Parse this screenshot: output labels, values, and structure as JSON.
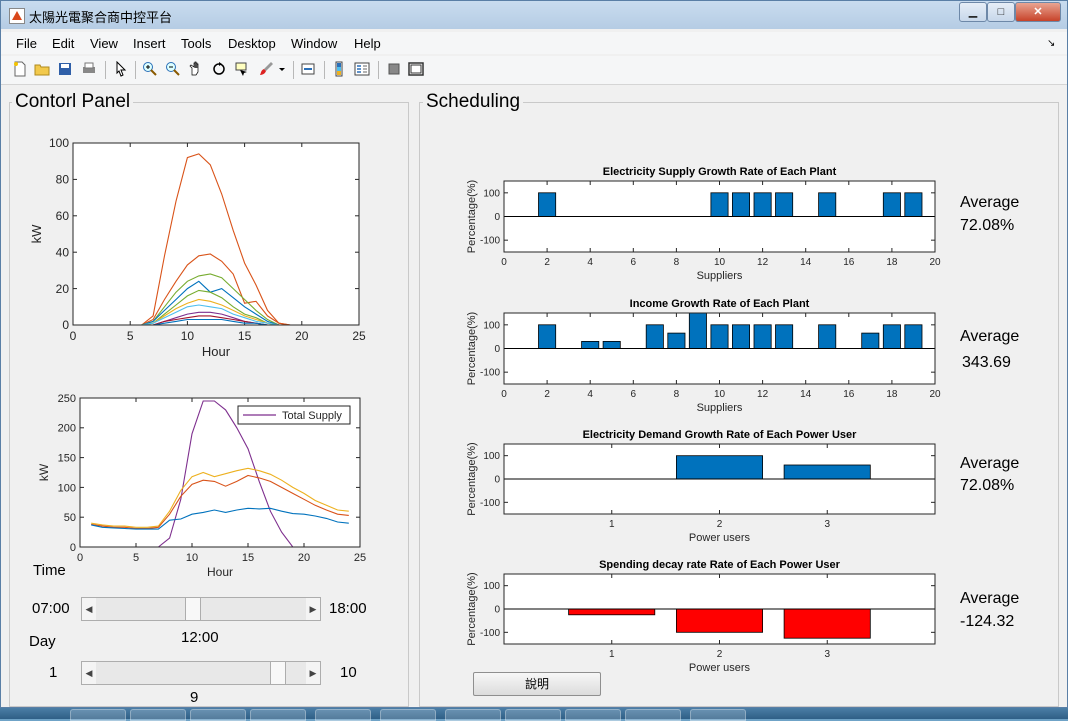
{
  "window": {
    "title": "太陽光電聚合商中控平台",
    "minimize": "▁",
    "maximize": "□",
    "close": "✕"
  },
  "menu": [
    "File",
    "Edit",
    "View",
    "Insert",
    "Tools",
    "Desktop",
    "Window",
    "Help"
  ],
  "menu_corner": "↘",
  "toolbar_icons": [
    "new-file-icon",
    "open-folder-icon",
    "save-icon",
    "print-icon",
    "pointer-icon",
    "zoom-in-icon",
    "zoom-out-icon",
    "pan-hand-icon",
    "rotate-icon",
    "data-cursor-icon",
    "brush-icon",
    "link-plot-icon",
    "colorbar-icon",
    "legend-icon",
    "hide-tools-icon",
    "dock-icon"
  ],
  "control_panel": {
    "title": "Contorl Panel",
    "time_label": "Time",
    "time_min": "07:00",
    "time_max": "18:00",
    "time_value": "12:00",
    "time_fraction": 0.4545,
    "day_label": "Day",
    "day_min": "1",
    "day_max": "10",
    "day_value": "9",
    "day_fraction": 0.8889
  },
  "scheduling": {
    "title": "Scheduling",
    "help_button": "說明"
  },
  "averages": [
    {
      "label": "Average",
      "value": "72.08%"
    },
    {
      "label": "Average",
      "value": "343.69"
    },
    {
      "label": "Average",
      "value": "72.08%"
    },
    {
      "label": "Average",
      "value": "-124.32"
    }
  ],
  "chart_data": [
    {
      "type": "line",
      "xlabel": "Hour",
      "ylabel": "kW",
      "xlim": [
        0,
        25
      ],
      "ylim": [
        0,
        100
      ],
      "xticks": [
        0,
        5,
        10,
        15,
        20,
        25
      ],
      "yticks": [
        0,
        20,
        40,
        60,
        80,
        100
      ],
      "x": [
        0,
        1,
        2,
        3,
        4,
        5,
        6,
        7,
        8,
        9,
        10,
        11,
        12,
        13,
        14,
        15,
        16,
        17,
        18,
        19,
        20,
        21,
        22,
        23,
        24
      ],
      "series": [
        {
          "color": "#d95319",
          "values": [
            0,
            0,
            0,
            0,
            0,
            0,
            0,
            5,
            38,
            68,
            92,
            94,
            88,
            72,
            52,
            34,
            22,
            8,
            1,
            0,
            0,
            0,
            0,
            0,
            0
          ]
        },
        {
          "color": "#d95319",
          "values": [
            0,
            0,
            0,
            0,
            0,
            0,
            0,
            3,
            14,
            24,
            33,
            38,
            39,
            35,
            28,
            12,
            13,
            5,
            1,
            0,
            0,
            0,
            0,
            0,
            0
          ]
        },
        {
          "color": "#77ac30",
          "values": [
            0,
            0,
            0,
            0,
            0,
            0,
            0,
            2,
            10,
            18,
            24,
            27,
            28,
            26,
            20,
            14,
            8,
            3,
            0,
            0,
            0,
            0,
            0,
            0,
            0
          ]
        },
        {
          "color": "#0072bd",
          "values": [
            0,
            0,
            0,
            0,
            0,
            0,
            0,
            2,
            8,
            14,
            20,
            24,
            18,
            20,
            15,
            10,
            6,
            2,
            0,
            0,
            0,
            0,
            0,
            0,
            0
          ]
        },
        {
          "color": "#77ac30",
          "values": [
            0,
            0,
            0,
            0,
            0,
            0,
            0,
            1,
            6,
            11,
            16,
            19,
            18,
            15,
            10,
            6,
            4,
            1,
            0,
            0,
            0,
            0,
            0,
            0,
            0
          ]
        },
        {
          "color": "#edb120",
          "values": [
            0,
            0,
            0,
            0,
            0,
            0,
            0,
            1,
            5,
            9,
            12,
            14,
            13,
            11,
            8,
            5,
            3,
            1,
            0,
            0,
            0,
            0,
            0,
            0,
            0
          ]
        },
        {
          "color": "#4dbeee",
          "values": [
            0,
            0,
            0,
            0,
            0,
            0,
            0,
            1,
            4,
            7,
            10,
            11,
            10,
            9,
            6,
            4,
            2,
            1,
            0,
            0,
            0,
            0,
            0,
            0,
            0
          ]
        },
        {
          "color": "#7e2f8e",
          "values": [
            0,
            0,
            0,
            0,
            0,
            0,
            0,
            0,
            2,
            4,
            6,
            7,
            7,
            6,
            4,
            2,
            1,
            0,
            0,
            0,
            0,
            0,
            0,
            0,
            0
          ]
        },
        {
          "color": "#a2142f",
          "values": [
            0,
            0,
            0,
            0,
            0,
            0,
            0,
            0,
            2,
            3,
            4,
            5,
            5,
            4,
            3,
            2,
            1,
            0,
            0,
            0,
            0,
            0,
            0,
            0,
            0
          ]
        },
        {
          "color": "#0072bd",
          "values": [
            0,
            0,
            0,
            0,
            0,
            0,
            0,
            0,
            1,
            2,
            3,
            3,
            3,
            3,
            2,
            1,
            1,
            0,
            0,
            0,
            0,
            0,
            0,
            0,
            0
          ]
        }
      ]
    },
    {
      "type": "line",
      "xlabel": "Hour",
      "ylabel": "kW",
      "xlim": [
        0,
        25
      ],
      "ylim": [
        0,
        250
      ],
      "xticks": [
        0,
        5,
        10,
        15,
        20,
        25
      ],
      "yticks": [
        0,
        50,
        100,
        150,
        200,
        250
      ],
      "x": [
        1,
        2,
        3,
        4,
        5,
        6,
        7,
        8,
        9,
        10,
        11,
        12,
        13,
        14,
        15,
        16,
        17,
        18,
        19,
        20,
        21,
        22,
        23,
        24
      ],
      "legend": "top-right",
      "series": [
        {
          "name": "Total Supply",
          "color": "#7e2f8e",
          "values": [
            0,
            0,
            0,
            0,
            0,
            0,
            0,
            15,
            80,
            190,
            245,
            245,
            230,
            200,
            165,
            110,
            60,
            25,
            0,
            0,
            0,
            0,
            0,
            0
          ]
        },
        {
          "color": "#edb120",
          "values": [
            40,
            37,
            35,
            35,
            33,
            33,
            35,
            60,
            95,
            118,
            125,
            118,
            123,
            128,
            132,
            128,
            122,
            112,
            100,
            90,
            78,
            70,
            62,
            60
          ]
        },
        {
          "color": "#d95319",
          "values": [
            38,
            35,
            33,
            33,
            31,
            31,
            33,
            55,
            85,
            105,
            112,
            110,
            102,
            110,
            120,
            116,
            110,
            100,
            90,
            80,
            70,
            62,
            55,
            53
          ]
        },
        {
          "color": "#0072bd",
          "values": [
            37,
            33,
            32,
            31,
            30,
            30,
            30,
            45,
            47,
            55,
            58,
            62,
            58,
            62,
            65,
            64,
            65,
            60,
            56,
            55,
            52,
            48,
            42,
            40
          ]
        }
      ]
    },
    {
      "type": "bar",
      "title": "Electricity Supply Growth Rate of Each Plant",
      "xlabel": "Suppliers",
      "ylabel": "Percentage(%)",
      "xlim": [
        0,
        20
      ],
      "ylim": [
        -150,
        150
      ],
      "xticks": [
        0,
        2,
        4,
        6,
        8,
        10,
        12,
        14,
        16,
        18,
        20
      ],
      "yticks": [
        -100,
        0,
        100
      ],
      "categories": [
        1,
        2,
        3,
        4,
        5,
        6,
        7,
        8,
        9,
        10,
        11,
        12,
        13,
        14,
        15,
        16,
        17,
        18,
        19
      ],
      "values": [
        0,
        100,
        0,
        0,
        0,
        0,
        0,
        0,
        0,
        100,
        100,
        100,
        100,
        0,
        100,
        0,
        0,
        100,
        100
      ],
      "color": "#0072bd"
    },
    {
      "type": "bar",
      "title": "Income Growth Rate of Each Plant",
      "xlabel": "Suppliers",
      "ylabel": "Percentage(%)",
      "xlim": [
        0,
        20
      ],
      "ylim": [
        -150,
        150
      ],
      "xticks": [
        0,
        2,
        4,
        6,
        8,
        10,
        12,
        14,
        16,
        18,
        20
      ],
      "yticks": [
        -100,
        0,
        100
      ],
      "categories": [
        1,
        2,
        3,
        4,
        5,
        6,
        7,
        8,
        9,
        10,
        11,
        12,
        13,
        14,
        15,
        16,
        17,
        18,
        19
      ],
      "values": [
        0,
        100,
        0,
        30,
        30,
        0,
        100,
        65,
        150,
        100,
        100,
        100,
        100,
        0,
        100,
        0,
        65,
        100,
        100
      ],
      "color": "#0072bd"
    },
    {
      "type": "bar",
      "title": "Electricity Demand Growth Rate of Each Power User",
      "xlabel": "Power users",
      "ylabel": "Percentage(%)",
      "xlim": [
        0,
        4
      ],
      "ylim": [
        -150,
        150
      ],
      "xticks": [
        1,
        2,
        3
      ],
      "yticks": [
        -100,
        0,
        100
      ],
      "categories": [
        1,
        2,
        3
      ],
      "values": [
        0,
        100,
        60
      ],
      "color": "#0072bd"
    },
    {
      "type": "bar",
      "title": "Spending decay rate Rate of Each Power User",
      "xlabel": "Power users",
      "ylabel": "Percentage(%)",
      "xlim": [
        0,
        4
      ],
      "ylim": [
        -150,
        150
      ],
      "xticks": [
        1,
        2,
        3
      ],
      "yticks": [
        -100,
        0,
        100
      ],
      "categories": [
        1,
        2,
        3
      ],
      "values": [
        -25,
        -100,
        -125
      ],
      "color": "#ff0000"
    }
  ]
}
